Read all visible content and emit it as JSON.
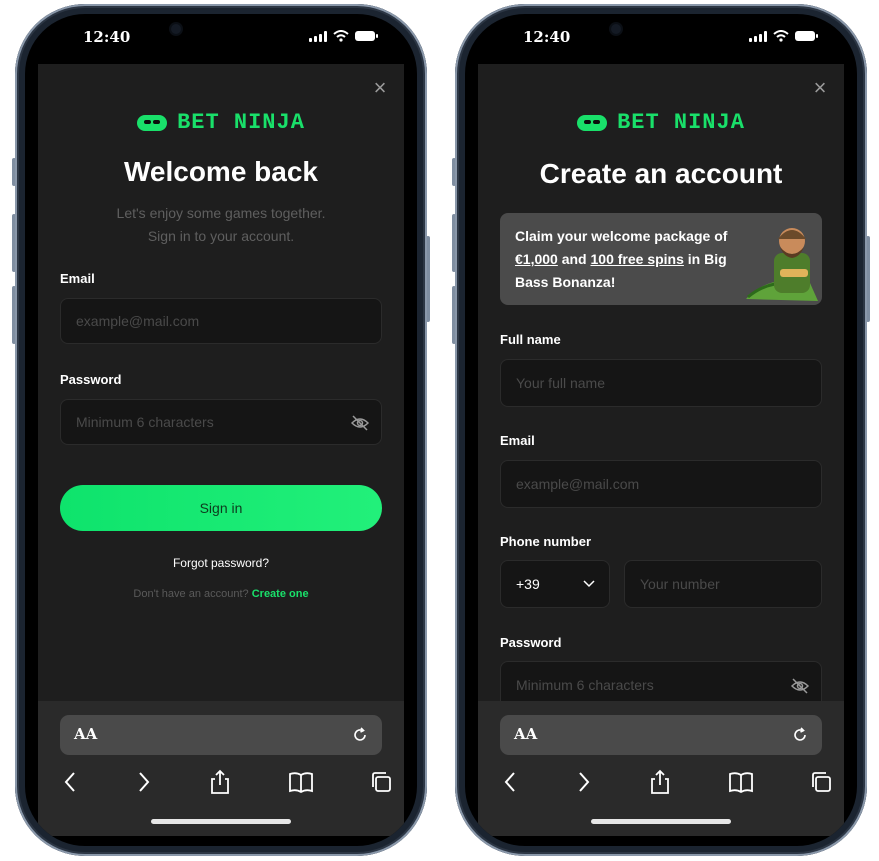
{
  "status": {
    "time": "12:40"
  },
  "login": {
    "logo_text": "BET NINJA",
    "heading": "Welcome back",
    "subtitle_line1": "Let's enjoy some games together.",
    "subtitle_line2": "Sign in to your account.",
    "email_label": "Email",
    "email_placeholder": "example@mail.com",
    "password_label": "Password",
    "password_placeholder": "Minimum 6 characters",
    "signin_label": "Sign in",
    "forgot_label": "Forgot password?",
    "no_account_text": "Don't have an account?",
    "create_link": "Create one"
  },
  "signup": {
    "logo_text": "BET NINJA",
    "heading": "Create an account",
    "promo": {
      "text_before": "Claim your welcome package of",
      "amount": "€1,000",
      "and": "and",
      "spins": "100 free spins",
      "text_after": "in Big Bass Bonanza!"
    },
    "fullname_label": "Full name",
    "fullname_placeholder": "Your full name",
    "email_label": "Email",
    "email_placeholder": "example@mail.com",
    "phone_label": "Phone number",
    "phone_code": "+39",
    "phone_placeholder": "Your number",
    "password_label": "Password",
    "password_placeholder": "Minimum 6 characters"
  },
  "browser": {
    "aa_label": "AA"
  },
  "colors": {
    "accent": "#19e06a",
    "background": "#1e1e1e",
    "field": "#151515"
  }
}
